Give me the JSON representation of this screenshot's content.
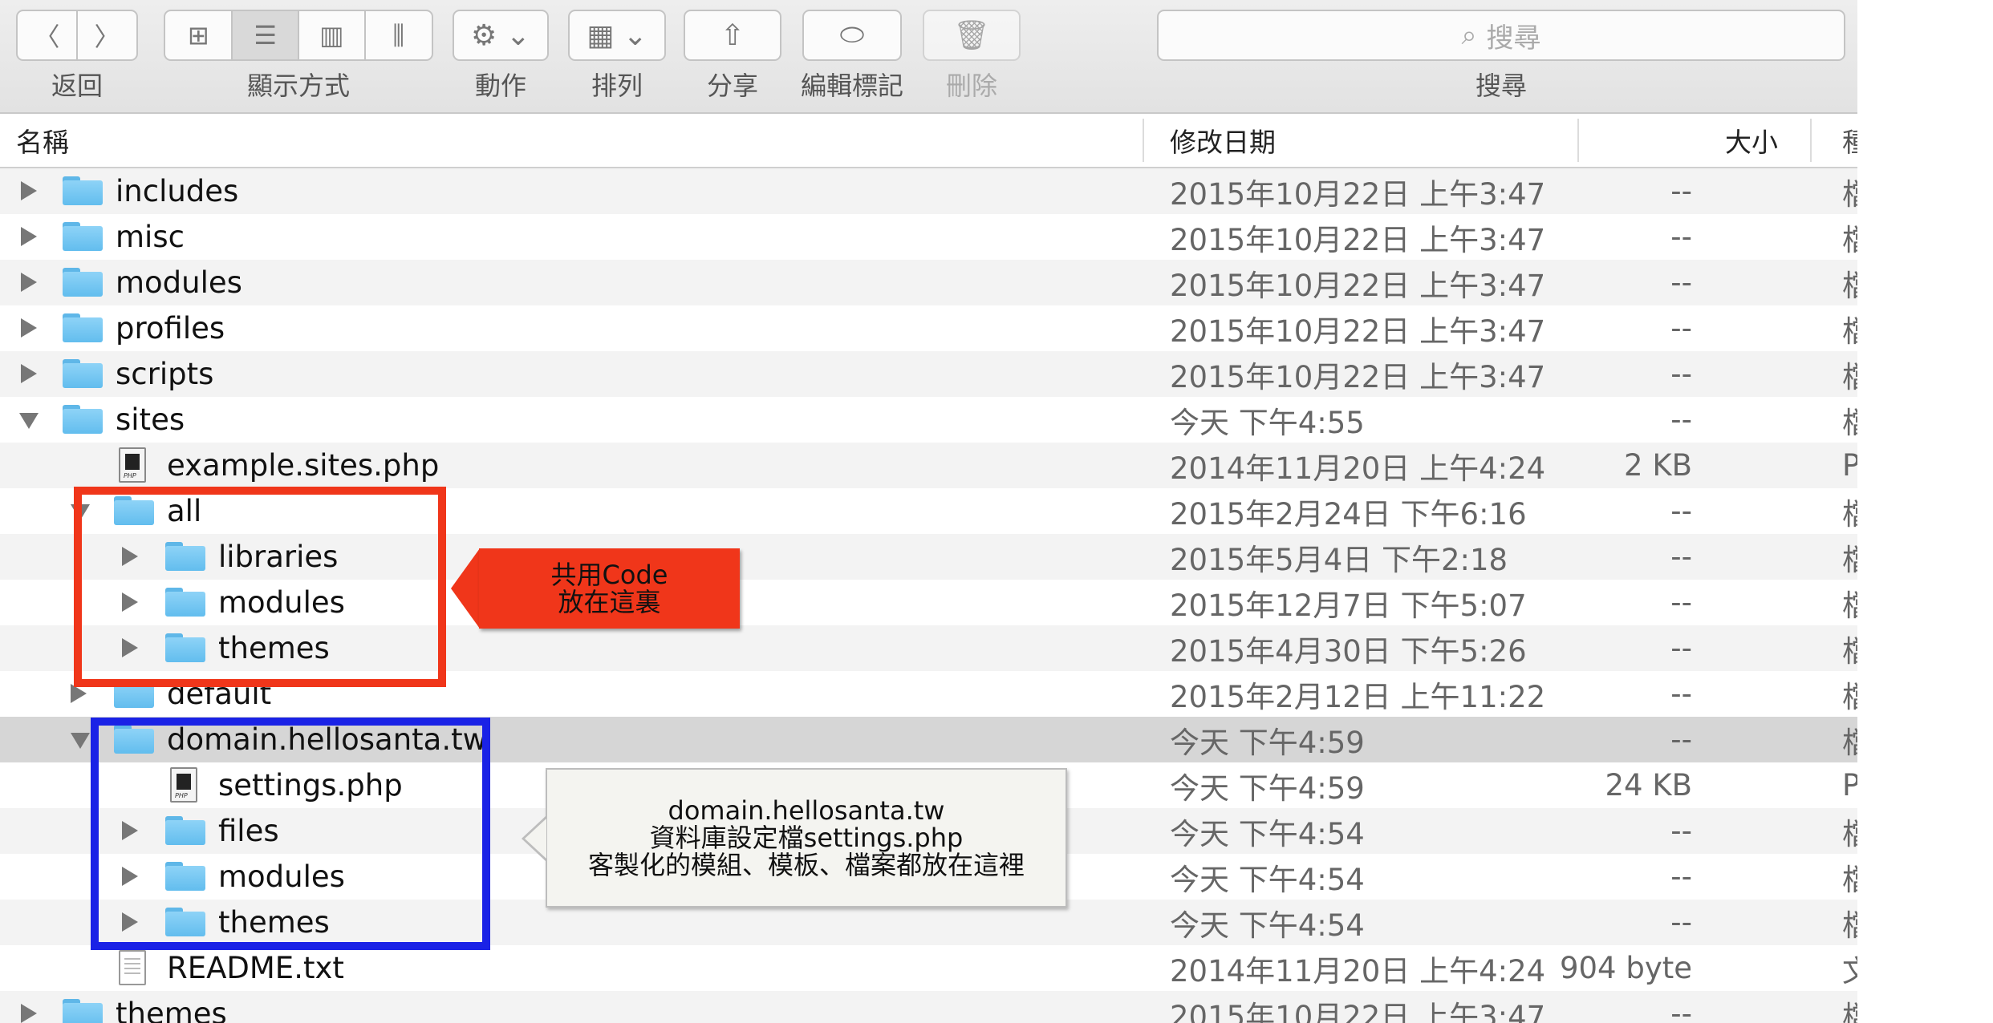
{
  "toolbar": {
    "back_label": "返回",
    "view_label": "顯示方式",
    "action_label": "動作",
    "arrange_label": "排列",
    "share_label": "分享",
    "tags_label": "編輯標記",
    "delete_label": "刪除",
    "search_label": "搜尋",
    "search_placeholder": "搜尋"
  },
  "columns": {
    "name": "名稱",
    "date": "修改日期",
    "size": "大小",
    "kind": "種"
  },
  "rows": [
    {
      "name": "includes",
      "date": "2015年10月22日 上午3:47",
      "size": "--",
      "kind": "檔"
    },
    {
      "name": "misc",
      "date": "2015年10月22日 上午3:47",
      "size": "--",
      "kind": "檔"
    },
    {
      "name": "modules",
      "date": "2015年10月22日 上午3:47",
      "size": "--",
      "kind": "檔"
    },
    {
      "name": "profiles",
      "date": "2015年10月22日 上午3:47",
      "size": "--",
      "kind": "檔"
    },
    {
      "name": "scripts",
      "date": "2015年10月22日 上午3:47",
      "size": "--",
      "kind": "檔"
    },
    {
      "name": "sites",
      "date": "今天 下午4:55",
      "size": "--",
      "kind": "檔"
    },
    {
      "name": "example.sites.php",
      "date": "2014年11月20日 上午4:24",
      "size": "2 KB",
      "kind": "P"
    },
    {
      "name": "all",
      "date": "2015年2月24日 下午6:16",
      "size": "--",
      "kind": "檔"
    },
    {
      "name": "libraries",
      "date": "2015年5月4日 下午2:18",
      "size": "--",
      "kind": "檔"
    },
    {
      "name": "modules",
      "date": "2015年12月7日 下午5:07",
      "size": "--",
      "kind": "檔"
    },
    {
      "name": "themes",
      "date": "2015年4月30日 下午5:26",
      "size": "--",
      "kind": "檔"
    },
    {
      "name": "default",
      "date": "2015年2月12日 上午11:22",
      "size": "--",
      "kind": "檔"
    },
    {
      "name": "domain.hellosanta.tw",
      "date": "今天 下午4:59",
      "size": "--",
      "kind": "檔"
    },
    {
      "name": "settings.php",
      "date": "今天 下午4:59",
      "size": "24 KB",
      "kind": "P"
    },
    {
      "name": "files",
      "date": "今天 下午4:54",
      "size": "--",
      "kind": "檔"
    },
    {
      "name": "modules",
      "date": "今天 下午4:54",
      "size": "--",
      "kind": "檔"
    },
    {
      "name": "themes",
      "date": "今天 下午4:54",
      "size": "--",
      "kind": "檔"
    },
    {
      "name": "README.txt",
      "date": "2014年11月20日 上午4:24",
      "size": "904 byte",
      "kind": "文"
    },
    {
      "name": "themes",
      "date": "2015年10月22日 上午3:47",
      "size": "--",
      "kind": "檔"
    }
  ],
  "annotations": {
    "red": {
      "line1": "共用Code",
      "line2": "放在這裏"
    },
    "gray": {
      "line1": "domain.hellosanta.tw",
      "line2": "資料庫設定檔settings.php",
      "line3": "客製化的模組、模板、檔案都放在這裡"
    }
  },
  "colors": {
    "red_box": "#f0361a",
    "blue_box": "#1a22e6",
    "folder": "#6cc3f2",
    "selected_row": "#d6d6d6"
  }
}
